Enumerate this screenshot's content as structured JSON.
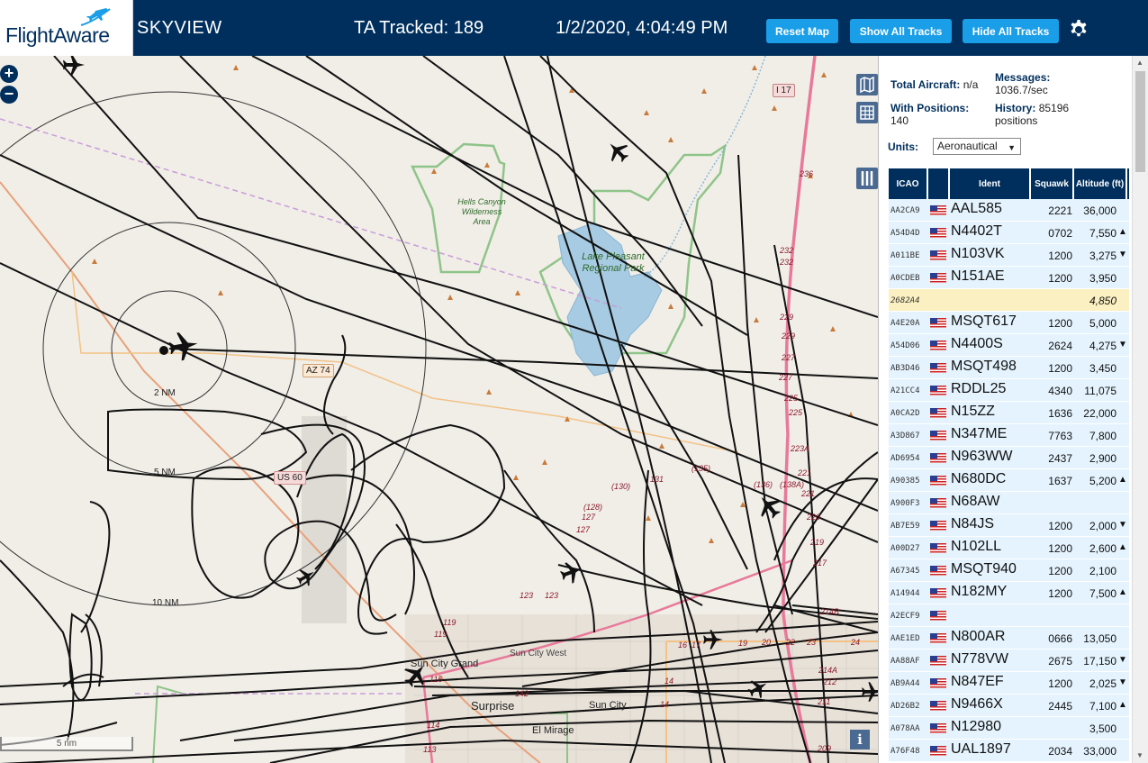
{
  "header": {
    "logo_text": "FlightAware",
    "title": "SKYVIEW",
    "tracked": "TA Tracked: 189",
    "datetime": "1/2/2020, 4:04:49 PM",
    "buttons": {
      "reset": "Reset Map",
      "show_all": "Show All Tracks",
      "hide_all": "Hide All Tracks"
    }
  },
  "map": {
    "zoom_in": "+",
    "zoom_out": "−",
    "info": "i",
    "scale": "5 nm",
    "ring_labels": [
      "2 NM",
      "5 NM",
      "10 NM"
    ],
    "places": {
      "hells_canyon": "Hells Canyon Wilderness Area",
      "lake_pleasant": "Lake Pleasant Regional Park",
      "az74": "AZ 74",
      "us60": "US 60",
      "i17": "I 17",
      "sun_city_grand": "Sun City Grand",
      "sun_city_west": "Sun City West",
      "surprise": "Surprise",
      "sun_city": "Sun City",
      "el_mirage": "El Mirage"
    },
    "road_numbers": [
      "236",
      "232",
      "232",
      "229",
      "229",
      "227",
      "227",
      "225",
      "225",
      "223A",
      "221",
      "221",
      "220",
      "219",
      "217",
      "(136)",
      "(138A)",
      "(135)",
      "131",
      "(130)",
      "(128)",
      "127",
      "127",
      "123",
      "123",
      "119",
      "119",
      "116",
      "114",
      "113",
      "142",
      "14",
      "14",
      "16",
      "17",
      "19",
      "20",
      "22",
      "23",
      "24",
      "214B",
      "214A",
      "211",
      "209",
      "212"
    ]
  },
  "panel": {
    "stats": {
      "total_label": "Total Aircraft:",
      "total_value": "n/a",
      "messages_label": "Messages:",
      "messages_value": "1036.7/sec",
      "positions_label": "With Positions:",
      "positions_value": "140",
      "history_label": "History:",
      "history_value": "85196 positions"
    },
    "units_label": "Units:",
    "units_value": "Aeronautical",
    "columns": [
      "ICAO",
      "",
      "Ident",
      "Squawk",
      "Altitude (ft)"
    ],
    "rows": [
      {
        "icao": "AA2CA9",
        "flag": true,
        "ident": "AAL585",
        "squawk": "2221",
        "alt": "36,000",
        "trend": ""
      },
      {
        "icao": "A54D4D",
        "flag": true,
        "ident": "N4402T",
        "squawk": "0702",
        "alt": "7,550",
        "trend": "▲"
      },
      {
        "icao": "A011BE",
        "flag": true,
        "ident": "N103VK",
        "squawk": "1200",
        "alt": "3,275",
        "trend": "▼"
      },
      {
        "icao": "A0CDEB",
        "flag": true,
        "ident": "N151AE",
        "squawk": "1200",
        "alt": "3,950",
        "trend": ""
      },
      {
        "icao": "2682A4",
        "flag": false,
        "ident": "",
        "squawk": "",
        "alt": "4,850",
        "trend": "",
        "selected": true
      },
      {
        "icao": "A4E20A",
        "flag": true,
        "ident": "MSQT617",
        "squawk": "1200",
        "alt": "5,000",
        "trend": ""
      },
      {
        "icao": "A54D06",
        "flag": true,
        "ident": "N4400S",
        "squawk": "2624",
        "alt": "4,275",
        "trend": "▼"
      },
      {
        "icao": "AB3D46",
        "flag": true,
        "ident": "MSQT498",
        "squawk": "1200",
        "alt": "3,450",
        "trend": ""
      },
      {
        "icao": "A21CC4",
        "flag": true,
        "ident": "RDDL25",
        "squawk": "4340",
        "alt": "11,075",
        "trend": ""
      },
      {
        "icao": "A0CA2D",
        "flag": true,
        "ident": "N15ZZ",
        "squawk": "1636",
        "alt": "22,000",
        "trend": ""
      },
      {
        "icao": "A3D867",
        "flag": true,
        "ident": "N347ME",
        "squawk": "7763",
        "alt": "7,800",
        "trend": ""
      },
      {
        "icao": "AD6954",
        "flag": true,
        "ident": "N963WW",
        "squawk": "2437",
        "alt": "2,900",
        "trend": ""
      },
      {
        "icao": "A90385",
        "flag": true,
        "ident": "N680DC",
        "squawk": "1637",
        "alt": "5,200",
        "trend": "▲"
      },
      {
        "icao": "A900F3",
        "flag": true,
        "ident": "N68AW",
        "squawk": "",
        "alt": "",
        "trend": ""
      },
      {
        "icao": "AB7E59",
        "flag": true,
        "ident": "N84JS",
        "squawk": "1200",
        "alt": "2,000",
        "trend": "▼"
      },
      {
        "icao": "A00D27",
        "flag": true,
        "ident": "N102LL",
        "squawk": "1200",
        "alt": "2,600",
        "trend": "▲"
      },
      {
        "icao": "A67345",
        "flag": true,
        "ident": "MSQT940",
        "squawk": "1200",
        "alt": "2,100",
        "trend": ""
      },
      {
        "icao": "A14944",
        "flag": true,
        "ident": "N182MY",
        "squawk": "1200",
        "alt": "7,500",
        "trend": "▲"
      },
      {
        "icao": "A2ECF9",
        "flag": true,
        "ident": "",
        "squawk": "",
        "alt": "",
        "trend": ""
      },
      {
        "icao": "AAE1ED",
        "flag": true,
        "ident": "N800AR",
        "squawk": "0666",
        "alt": "13,050",
        "trend": ""
      },
      {
        "icao": "AA88AF",
        "flag": true,
        "ident": "N778VW",
        "squawk": "2675",
        "alt": "17,150",
        "trend": "▼"
      },
      {
        "icao": "AB9A44",
        "flag": true,
        "ident": "N847EF",
        "squawk": "1200",
        "alt": "2,025",
        "trend": "▼"
      },
      {
        "icao": "AD26B2",
        "flag": true,
        "ident": "N9466X",
        "squawk": "2445",
        "alt": "7,100",
        "trend": "▲"
      },
      {
        "icao": "A078AA",
        "flag": true,
        "ident": "N12980",
        "squawk": "",
        "alt": "3,500",
        "trend": ""
      },
      {
        "icao": "A76F48",
        "flag": true,
        "ident": "UAL1897",
        "squawk": "2034",
        "alt": "33,000",
        "trend": ""
      }
    ]
  },
  "colors": {
    "header": "#002f5d",
    "button": "#1a9ee8",
    "row": "#e4f3fd",
    "row_selected": "#fbf0c1",
    "map_bg": "#f1eee8",
    "lake": "#a6cbe3",
    "park_border": "#8fc489",
    "road": "#e8799a"
  }
}
